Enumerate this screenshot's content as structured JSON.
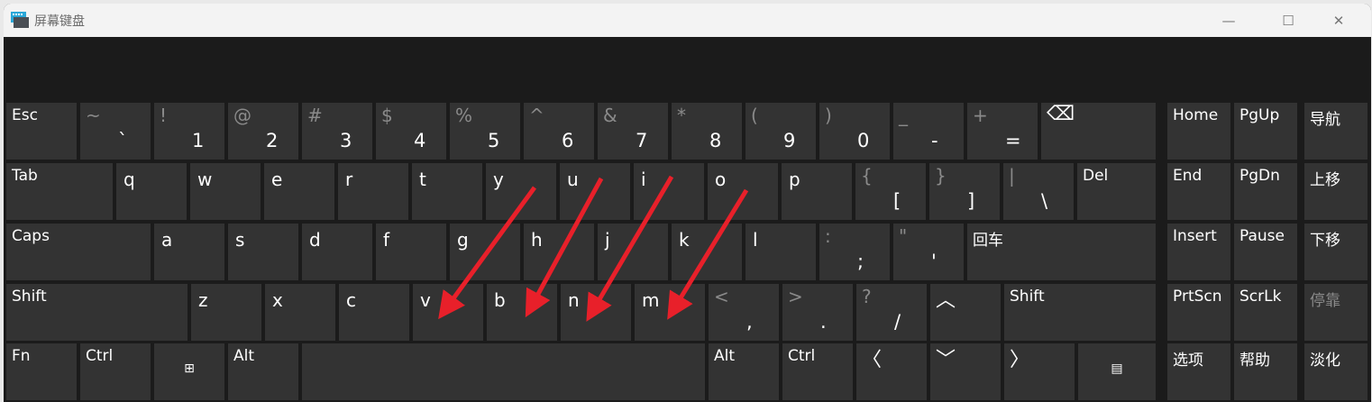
{
  "window": {
    "title": "屏幕键盘",
    "minimize": "—",
    "maximize": "☐",
    "close": "✕"
  },
  "main_rows": [
    [
      {
        "id": "esc",
        "type": "word",
        "m": "Esc"
      },
      {
        "id": "backtick",
        "type": "dual",
        "s": "~",
        "m": "`"
      },
      {
        "id": "1",
        "type": "dual",
        "s": "!",
        "m": "1"
      },
      {
        "id": "2",
        "type": "dual",
        "s": "@",
        "m": "2"
      },
      {
        "id": "3",
        "type": "dual",
        "s": "#",
        "m": "3"
      },
      {
        "id": "4",
        "type": "dual",
        "s": "$",
        "m": "4"
      },
      {
        "id": "5",
        "type": "dual",
        "s": "%",
        "m": "5"
      },
      {
        "id": "6",
        "type": "dual",
        "s": "^",
        "m": "6"
      },
      {
        "id": "7",
        "type": "dual",
        "s": "&",
        "m": "7"
      },
      {
        "id": "8",
        "type": "dual",
        "s": "*",
        "m": "8"
      },
      {
        "id": "9",
        "type": "dual",
        "s": "(",
        "m": "9"
      },
      {
        "id": "0",
        "type": "dual",
        "s": ")",
        "m": "0"
      },
      {
        "id": "minus",
        "type": "dual",
        "s": "_",
        "m": "-"
      },
      {
        "id": "equals",
        "type": "dual",
        "s": "+",
        "m": "="
      },
      {
        "id": "backspace",
        "type": "icon",
        "m": "⌫"
      }
    ],
    [
      {
        "id": "tab",
        "type": "word",
        "m": "Tab"
      },
      {
        "id": "q",
        "type": "letter",
        "m": "q"
      },
      {
        "id": "w",
        "type": "letter",
        "m": "w"
      },
      {
        "id": "e",
        "type": "letter",
        "m": "e"
      },
      {
        "id": "r",
        "type": "letter",
        "m": "r"
      },
      {
        "id": "t",
        "type": "letter",
        "m": "t"
      },
      {
        "id": "y",
        "type": "letter",
        "m": "y"
      },
      {
        "id": "u",
        "type": "letter",
        "m": "u"
      },
      {
        "id": "i",
        "type": "letter",
        "m": "i"
      },
      {
        "id": "o",
        "type": "letter",
        "m": "o"
      },
      {
        "id": "p",
        "type": "letter",
        "m": "p"
      },
      {
        "id": "lbracket",
        "type": "dual",
        "s": "{",
        "m": "["
      },
      {
        "id": "rbracket",
        "type": "dual",
        "s": "}",
        "m": "]"
      },
      {
        "id": "backslash",
        "type": "dual",
        "s": "|",
        "m": "\\"
      },
      {
        "id": "del",
        "type": "word",
        "m": "Del"
      }
    ],
    [
      {
        "id": "caps",
        "type": "word",
        "m": "Caps"
      },
      {
        "id": "a",
        "type": "letter",
        "m": "a"
      },
      {
        "id": "s",
        "type": "letter",
        "m": "s"
      },
      {
        "id": "d",
        "type": "letter",
        "m": "d"
      },
      {
        "id": "f",
        "type": "letter",
        "m": "f"
      },
      {
        "id": "g",
        "type": "letter",
        "m": "g"
      },
      {
        "id": "h",
        "type": "letter",
        "m": "h"
      },
      {
        "id": "j",
        "type": "letter",
        "m": "j"
      },
      {
        "id": "k",
        "type": "letter",
        "m": "k"
      },
      {
        "id": "l",
        "type": "letter",
        "m": "l"
      },
      {
        "id": "semicolon",
        "type": "dual",
        "s": ":",
        "m": ";"
      },
      {
        "id": "quote",
        "type": "dual",
        "s": "\"",
        "m": "'"
      },
      {
        "id": "enter",
        "type": "word",
        "m": "回车"
      }
    ],
    [
      {
        "id": "lshift",
        "type": "word",
        "m": "Shift"
      },
      {
        "id": "z",
        "type": "letter",
        "m": "z"
      },
      {
        "id": "x",
        "type": "letter",
        "m": "x"
      },
      {
        "id": "c",
        "type": "letter",
        "m": "c"
      },
      {
        "id": "v",
        "type": "letter",
        "m": "v"
      },
      {
        "id": "b",
        "type": "letter",
        "m": "b"
      },
      {
        "id": "n",
        "type": "letter",
        "m": "n"
      },
      {
        "id": "m",
        "type": "letter",
        "m": "m"
      },
      {
        "id": "comma",
        "type": "dual",
        "s": "<",
        "m": ","
      },
      {
        "id": "period",
        "type": "dual",
        "s": ">",
        "m": "."
      },
      {
        "id": "slash",
        "type": "dual",
        "s": "?",
        "m": "/"
      },
      {
        "id": "up",
        "type": "icon",
        "m": "︿"
      },
      {
        "id": "rshift",
        "type": "word",
        "m": "Shift"
      }
    ],
    [
      {
        "id": "fn",
        "type": "word",
        "m": "Fn"
      },
      {
        "id": "lctrl",
        "type": "word",
        "m": "Ctrl"
      },
      {
        "id": "win",
        "type": "center",
        "m": "⊞"
      },
      {
        "id": "lalt",
        "type": "word",
        "m": "Alt"
      },
      {
        "id": "space",
        "type": "word",
        "m": ""
      },
      {
        "id": "ralt",
        "type": "word",
        "m": "Alt"
      },
      {
        "id": "rctrl",
        "type": "word",
        "m": "Ctrl"
      },
      {
        "id": "left",
        "type": "icon",
        "m": "〈"
      },
      {
        "id": "down",
        "type": "icon",
        "m": "﹀"
      },
      {
        "id": "right",
        "type": "icon",
        "m": "〉"
      },
      {
        "id": "menu",
        "type": "center",
        "m": "▤"
      }
    ]
  ],
  "nav_rows": [
    [
      {
        "id": "home",
        "type": "word",
        "m": "Home"
      },
      {
        "id": "pgup",
        "type": "word",
        "m": "PgUp"
      },
      {
        "id": "nav",
        "type": "word",
        "m": "导航"
      }
    ],
    [
      {
        "id": "end",
        "type": "word",
        "m": "End"
      },
      {
        "id": "pgdn",
        "type": "word",
        "m": "PgDn"
      },
      {
        "id": "moveup",
        "type": "word",
        "m": "上移"
      }
    ],
    [
      {
        "id": "insert",
        "type": "word",
        "m": "Insert"
      },
      {
        "id": "pause",
        "type": "word",
        "m": "Pause"
      },
      {
        "id": "movedown",
        "type": "word",
        "m": "下移"
      }
    ],
    [
      {
        "id": "prtscn",
        "type": "word",
        "m": "PrtScn"
      },
      {
        "id": "scrlk",
        "type": "word",
        "m": "ScrLk"
      },
      {
        "id": "dock",
        "type": "word dim",
        "m": "停靠"
      }
    ],
    [
      {
        "id": "options",
        "type": "word",
        "m": "选项"
      },
      {
        "id": "help",
        "type": "word",
        "m": "帮助"
      },
      {
        "id": "fade",
        "type": "word",
        "m": "淡化"
      }
    ]
  ],
  "colors": {
    "key_bg": "#333333",
    "window_bg": "#1b1b1b",
    "annotation_arrow": "#e8202a"
  }
}
